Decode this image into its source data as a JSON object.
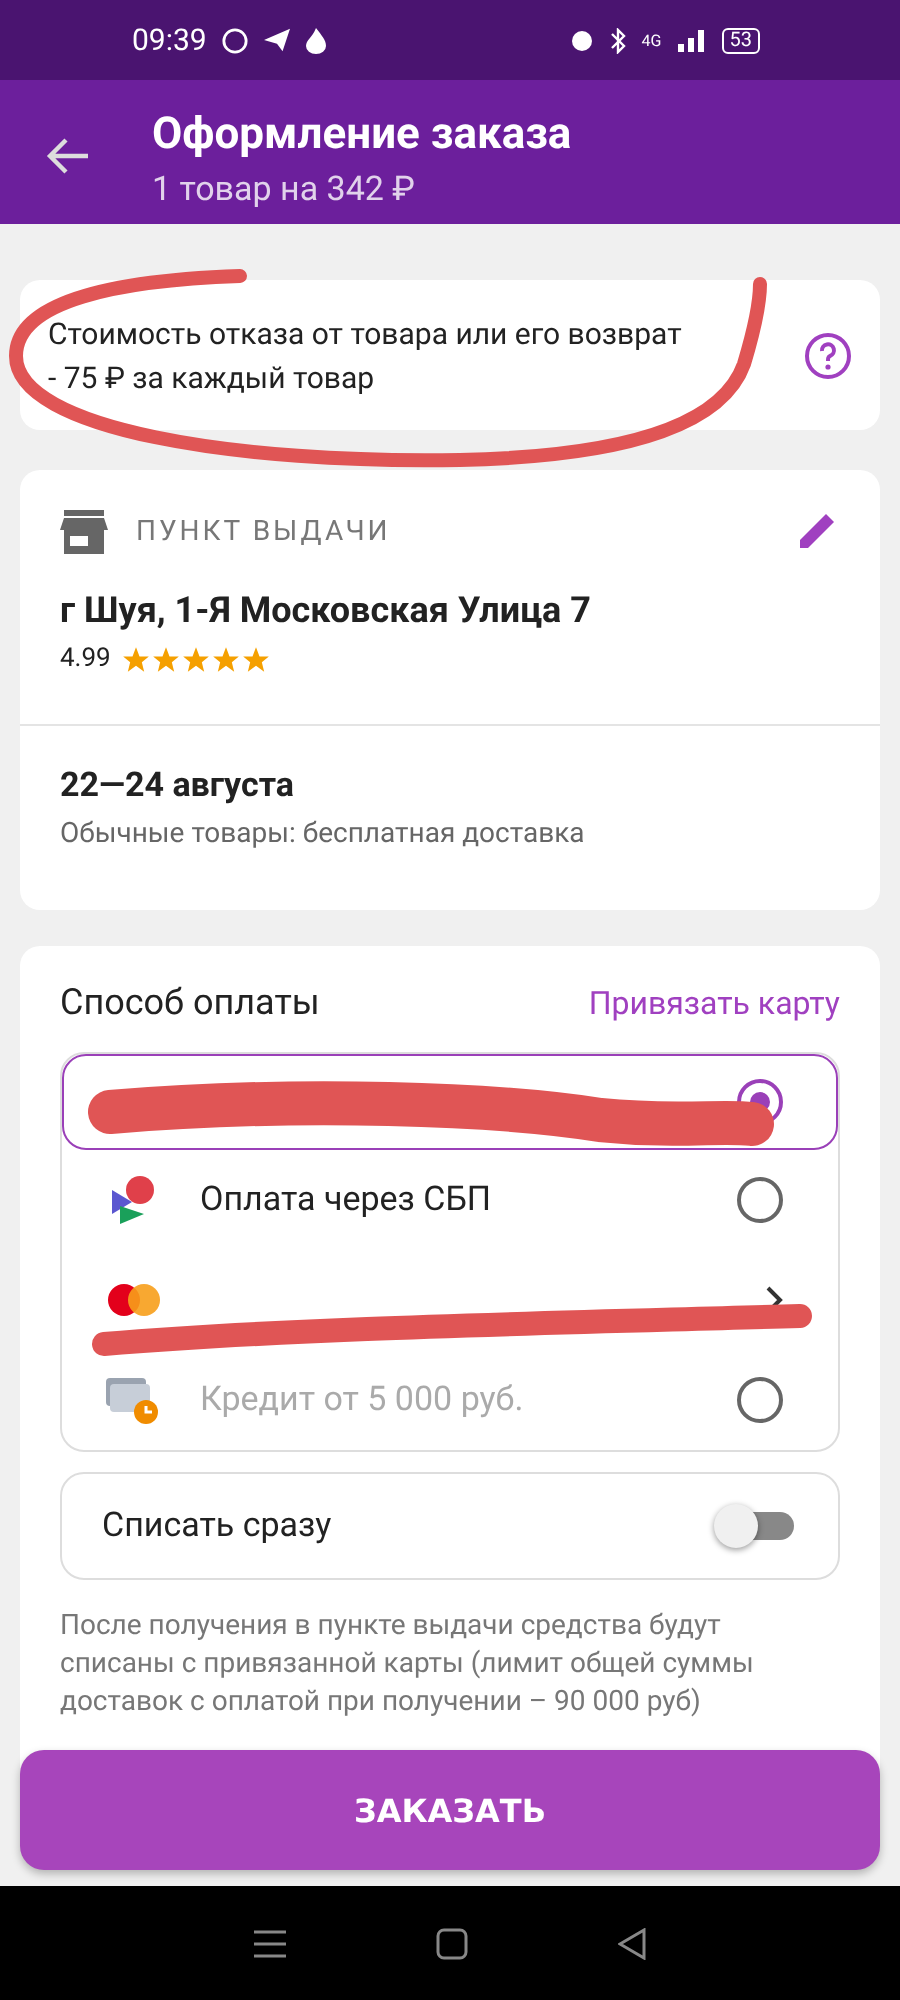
{
  "status_bar": {
    "time": "09:39",
    "network": "4G",
    "battery": "53"
  },
  "header": {
    "title": "Оформление заказа",
    "subtitle": "1 товар на 342 ₽"
  },
  "notice": {
    "text": "Стоимость отказа от товара или его возврат - 75 ₽ за каждый товар"
  },
  "pickup": {
    "label": "ПУНКТ ВЫДАЧИ",
    "address": "г Шуя, 1-Я Московская Улица 7",
    "rating": "4.99",
    "stars": 5,
    "date": "22—24 августа",
    "note": "Обычные товары: бесплатная доставка"
  },
  "payment": {
    "title": "Способ оплаты",
    "link": "Привязать карту",
    "options": [
      {
        "kind": "radio",
        "selected": true,
        "disabled": false
      },
      {
        "kind": "radio",
        "label": "Оплата через СБП",
        "selected": false,
        "disabled": false
      },
      {
        "kind": "link"
      },
      {
        "kind": "radio",
        "label": "Кредит от 5 000 руб.",
        "selected": false,
        "disabled": true
      }
    ],
    "toggle": {
      "label": "Списать сразу",
      "on": false
    },
    "note": "После получения в пункте выдачи средства будут списаны с привязанной карты (лимит общей суммы доставок с оплатой при получении – 90 000 руб)"
  },
  "order_button": {
    "label": "ЗАКАЗАТЬ"
  }
}
